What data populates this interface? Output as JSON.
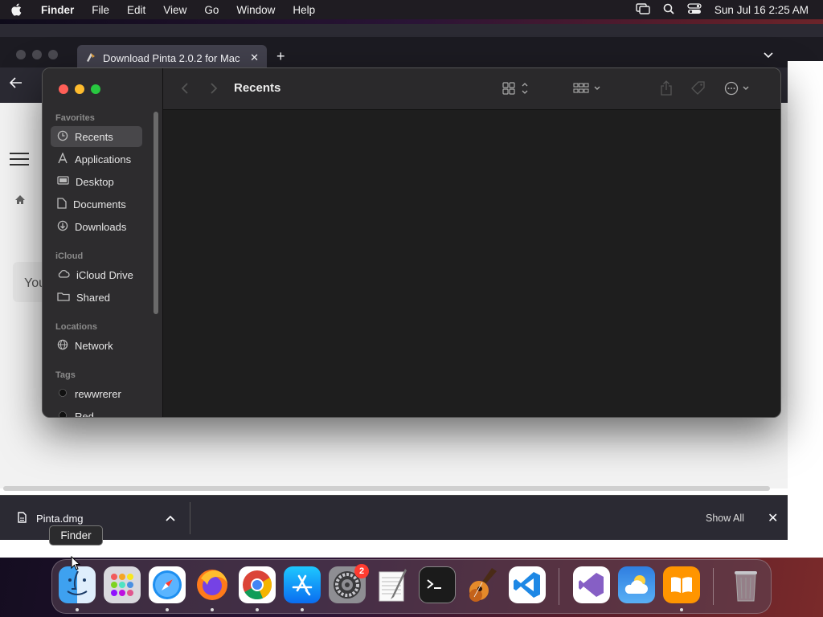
{
  "menubar": {
    "app_name": "Finder",
    "items": [
      "File",
      "Edit",
      "View",
      "Go",
      "Window",
      "Help"
    ],
    "clock": "Sun Jul 16  2:25 AM"
  },
  "browser": {
    "tab_title": "Download Pinta 2.0.2 for Mac",
    "page_partial_text": "You",
    "download": {
      "file_name": "Pinta.dmg",
      "show_all_label": "Show All"
    }
  },
  "finder": {
    "title": "Recents",
    "sidebar": {
      "favorites_header": "Favorites",
      "favorites": [
        {
          "label": "Recents",
          "icon": "clock-icon",
          "selected": true
        },
        {
          "label": "Applications",
          "icon": "applications-icon"
        },
        {
          "label": "Desktop",
          "icon": "desktop-icon"
        },
        {
          "label": "Documents",
          "icon": "document-icon"
        },
        {
          "label": "Downloads",
          "icon": "download-icon"
        }
      ],
      "icloud_header": "iCloud",
      "icloud": [
        {
          "label": "iCloud Drive",
          "icon": "cloud-icon"
        },
        {
          "label": "Shared",
          "icon": "shared-folder-icon"
        }
      ],
      "locations_header": "Locations",
      "locations": [
        {
          "label": "Network",
          "icon": "globe-icon"
        }
      ],
      "tags_header": "Tags",
      "tags": [
        {
          "label": "rewwrerer",
          "color": "#111111"
        },
        {
          "label": "Red",
          "color": "#111111"
        }
      ]
    }
  },
  "tooltip": {
    "text": "Finder"
  },
  "dock": {
    "apps": [
      {
        "name": "Finder",
        "icon": "finder-icon",
        "running": true
      },
      {
        "name": "Launchpad",
        "icon": "launchpad-icon",
        "running": false
      },
      {
        "name": "Safari",
        "icon": "safari-icon",
        "running": true
      },
      {
        "name": "Firefox",
        "icon": "firefox-icon",
        "running": true
      },
      {
        "name": "Google Chrome",
        "icon": "chrome-icon",
        "running": true
      },
      {
        "name": "App Store",
        "icon": "app-store-icon",
        "running": true
      },
      {
        "name": "System Settings",
        "icon": "settings-icon",
        "running": false,
        "badge": "2"
      },
      {
        "name": "TextEdit",
        "icon": "textedit-icon",
        "running": false
      },
      {
        "name": "Terminal",
        "icon": "terminal-icon",
        "running": false
      },
      {
        "name": "GarageBand",
        "icon": "garageband-icon",
        "running": false
      },
      {
        "name": "Visual Studio Code",
        "icon": "vscode-icon",
        "running": false
      },
      {
        "name": "Visual Studio",
        "icon": "visual-studio-icon",
        "running": false
      },
      {
        "name": "Weather",
        "icon": "weather-icon",
        "running": false
      },
      {
        "name": "Books",
        "icon": "books-icon",
        "running": false
      },
      {
        "name": "Trash",
        "icon": "trash-icon",
        "running": false
      }
    ]
  },
  "colors": {
    "close": "#ff5f57",
    "minimize": "#febc2e",
    "zoom": "#28c840",
    "badge": "#ff3b30"
  }
}
